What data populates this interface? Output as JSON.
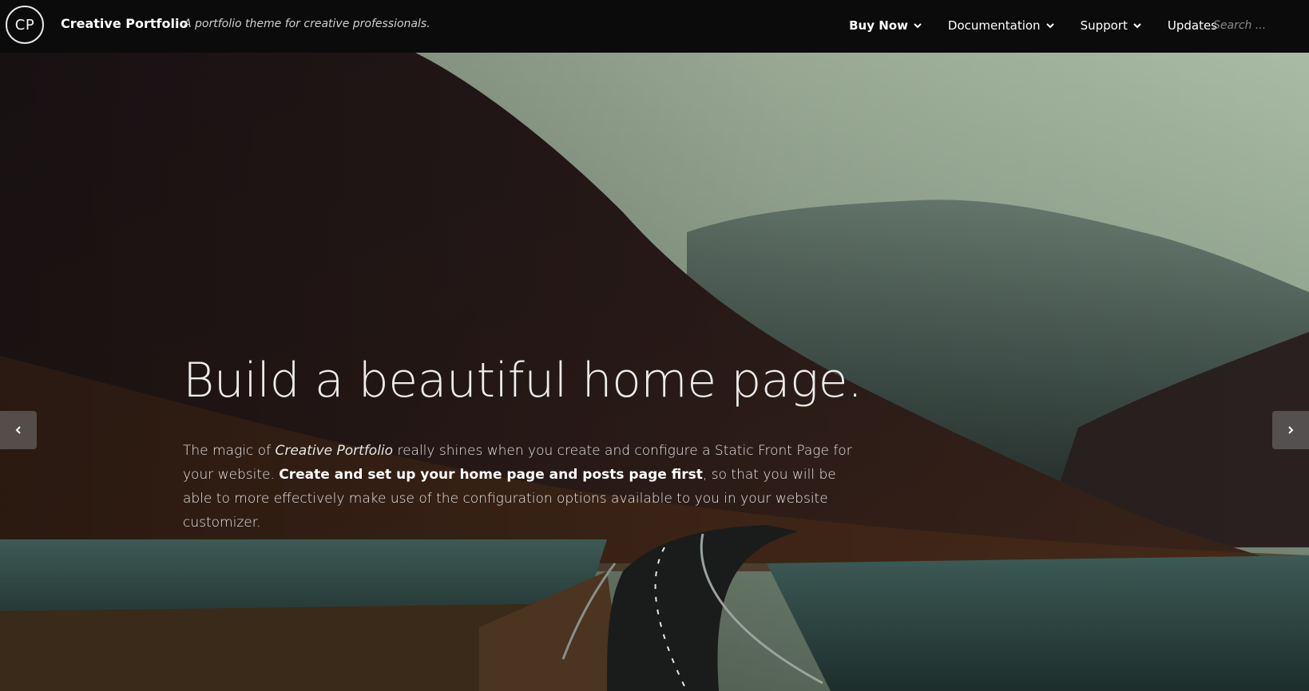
{
  "header": {
    "logo_text": "CP",
    "site_title": "Creative Portfolio",
    "tagline": "A portfolio theme for creative professionals.",
    "nav": [
      {
        "label": "Buy Now",
        "has_dropdown": true
      },
      {
        "label": "Documentation",
        "has_dropdown": true
      },
      {
        "label": "Support",
        "has_dropdown": true
      },
      {
        "label": "Updates",
        "has_dropdown": false
      }
    ],
    "search_placeholder": "Search ..."
  },
  "hero": {
    "title": "Build a beautiful home page.",
    "text": {
      "part1": "The magic of ",
      "em": "Creative Portfolio",
      "part2": " really shines when you create and configure a Static Front Page for your website. ",
      "strong": "Create and set up your home page and posts page first",
      "part3": ", so that you will be able to more effectively make use of the configuration options available to you in your website customizer."
    },
    "prev_icon": "chevron-left-icon",
    "next_icon": "chevron-right-icon"
  },
  "colors": {
    "header_bg": "#0b0b0b",
    "text": "#ececec",
    "arrow_bg": "rgba(120,120,120,0.55)"
  }
}
